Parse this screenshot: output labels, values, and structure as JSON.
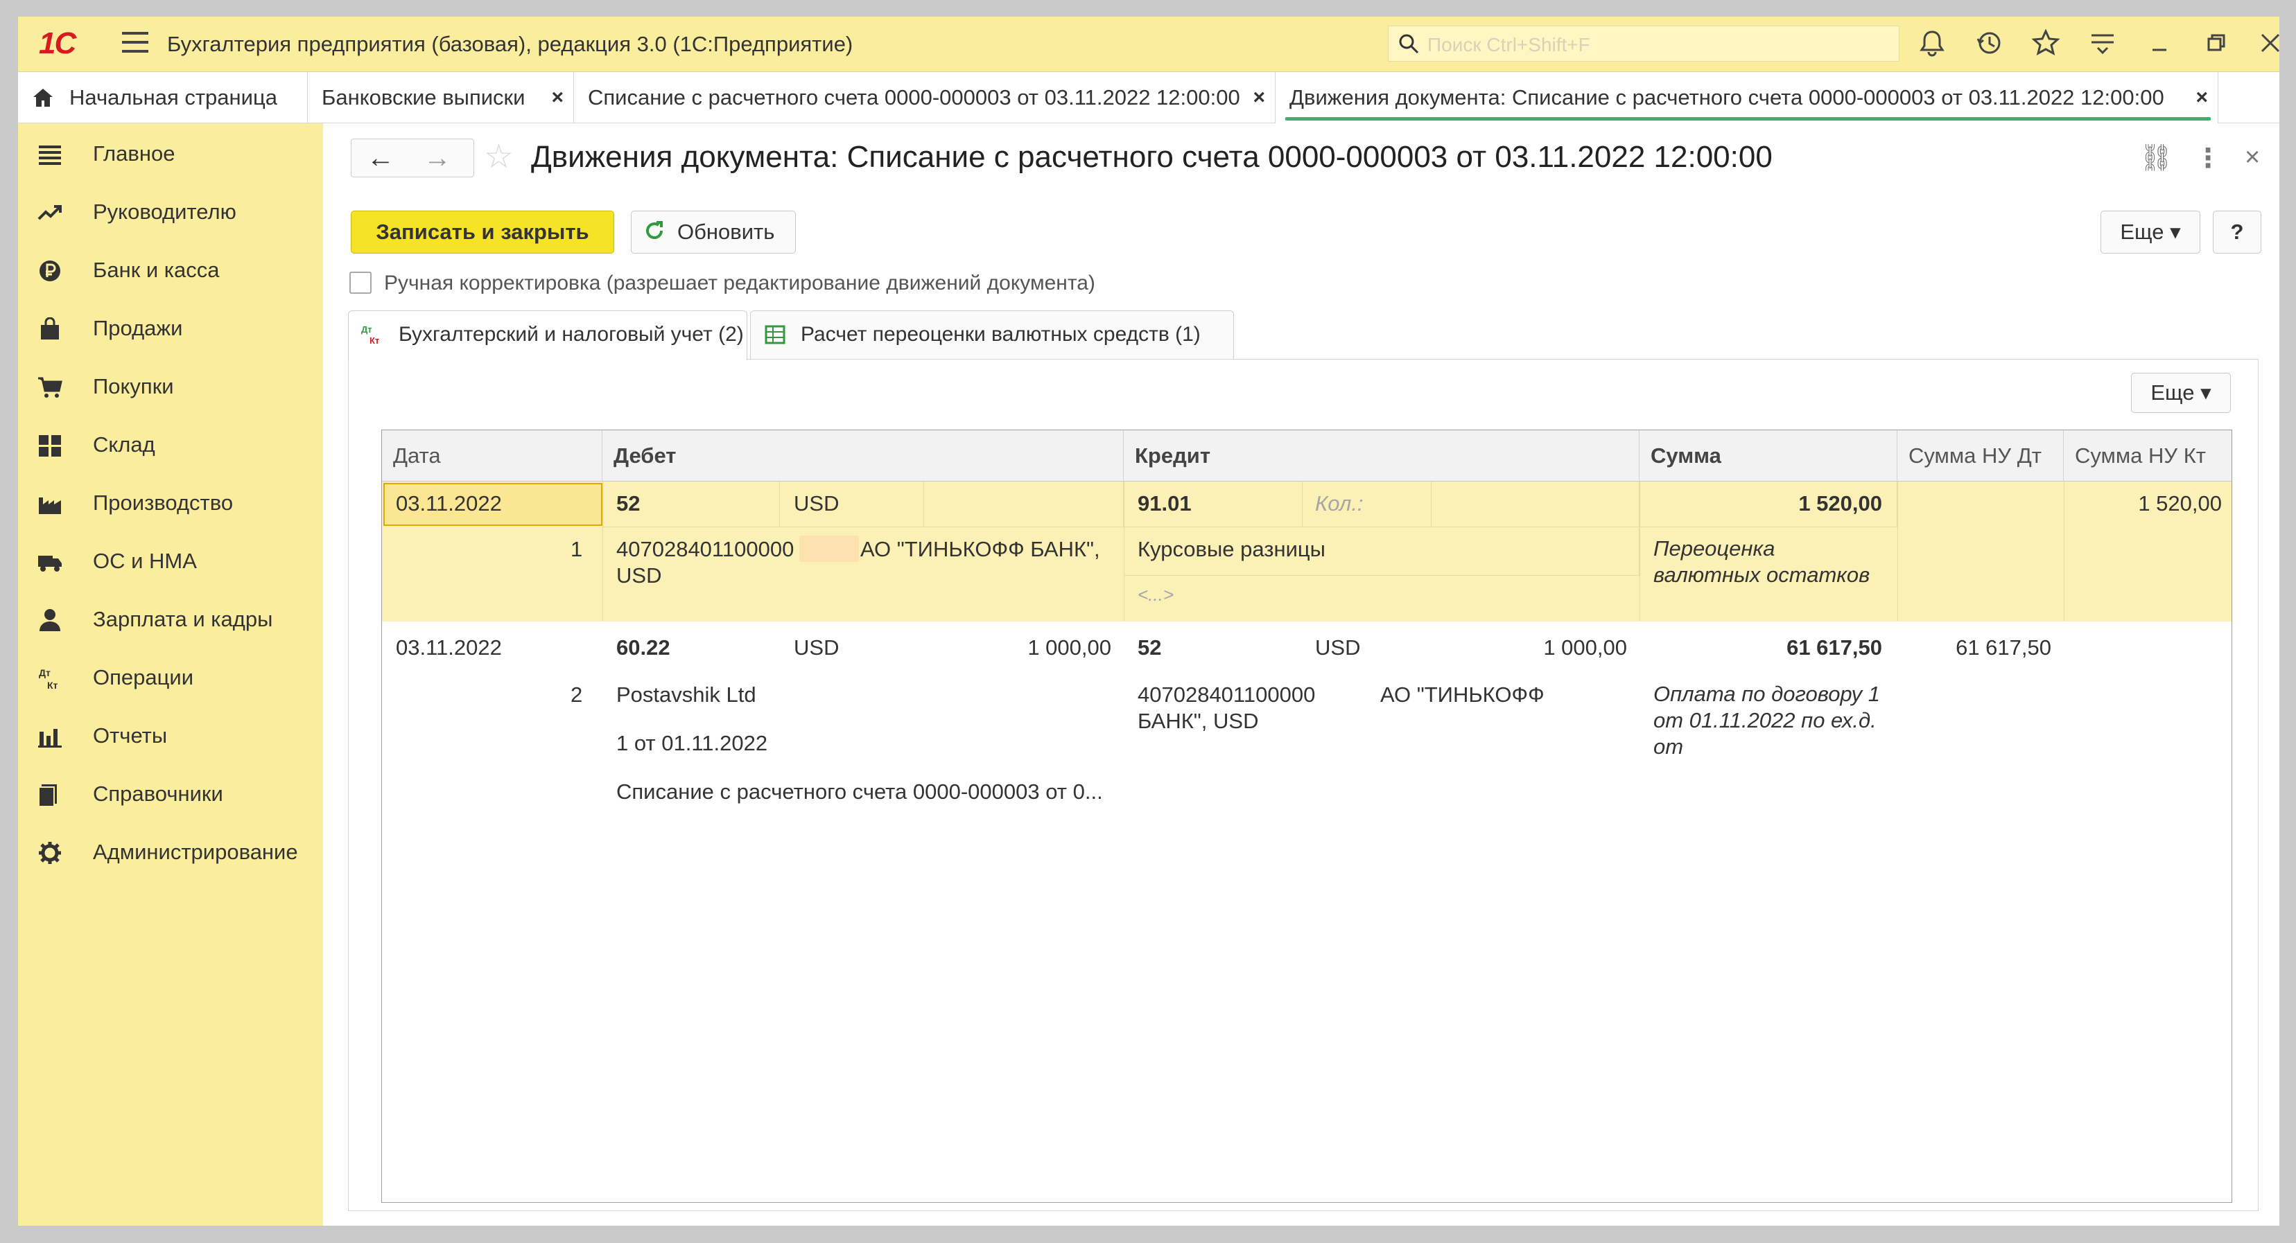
{
  "app": {
    "logo": "1С",
    "title": "Бухгалтерия предприятия (базовая), редакция 3.0  (1С:Предприятие)",
    "search_placeholder": "Поиск Ctrl+Shift+F"
  },
  "tabs": [
    {
      "label": "Начальная страница"
    },
    {
      "label": "Банковские выписки",
      "close": "×"
    },
    {
      "label": "Списание с расчетного счета 0000-000003 от 03.11.2022 12:00:00",
      "close": "×"
    },
    {
      "label": "Движения документа: Списание с расчетного счета 0000-000003 от 03.11.2022 12:00:00",
      "close": "×"
    }
  ],
  "sidebar": {
    "items": [
      {
        "label": "Главное",
        "icon": "menu-icon"
      },
      {
        "label": "Руководителю",
        "icon": "chart-trend-icon"
      },
      {
        "label": "Банк и касса",
        "icon": "ruble-coin-icon"
      },
      {
        "label": "Продажи",
        "icon": "shopping-bag-icon"
      },
      {
        "label": "Покупки",
        "icon": "cart-icon"
      },
      {
        "label": "Склад",
        "icon": "warehouse-icon"
      },
      {
        "label": "Производство",
        "icon": "factory-icon"
      },
      {
        "label": "ОС и НМА",
        "icon": "truck-icon"
      },
      {
        "label": "Зарплата и кадры",
        "icon": "person-icon"
      },
      {
        "label": "Операции",
        "icon": "dt-kt-icon"
      },
      {
        "label": "Отчеты",
        "icon": "bar-chart-icon"
      },
      {
        "label": "Справочники",
        "icon": "books-icon"
      },
      {
        "label": "Администрирование",
        "icon": "gear-icon"
      }
    ]
  },
  "document": {
    "title": "Движения документа: Списание с расчетного счета 0000-000003 от 03.11.2022 12:00:00",
    "back": "←",
    "forward": "→",
    "star": "☆",
    "link_icon": "⛓",
    "more_icon": "⋮",
    "close_icon": "×"
  },
  "toolbar": {
    "save_close": "Записать и закрыть",
    "refresh": "Обновить",
    "more": "Еще ▾",
    "help": "?"
  },
  "manual_edit": {
    "label": "Ручная корректировка (разрешает редактирование движений документа)",
    "checked": false
  },
  "subtabs": [
    {
      "label": "Бухгалтерский и налоговый учет (2)",
      "icon": "dt-kt-icon"
    },
    {
      "label": "Расчет переоценки валютных средств (1)",
      "icon": "table-icon"
    }
  ],
  "table_more": "Еще ▾",
  "table": {
    "headers": [
      "Дата",
      "Дебет",
      "Кредит",
      "Сумма",
      "Сумма НУ Дт",
      "Сумма НУ Кт"
    ],
    "rows": [
      {
        "date": "03.11.2022",
        "num": "1",
        "debit_account": "52",
        "debit_currency": "USD",
        "debit_sub1": "407028401100000",
        "debit_sub1_bank": "АО \"ТИНЬКОФФ БАНК\",",
        "debit_sub1_cont": "USD",
        "credit_account": "91.01",
        "credit_qty_placeholder": "Кол.:",
        "credit_sub1": "Курсовые разницы",
        "credit_sub2": "<...>",
        "sum": "1 520,00",
        "sum_content": "Переоценка валютных остатков",
        "sum_nu_dt": "",
        "sum_nu_kt": "1 520,00"
      },
      {
        "date": "03.11.2022",
        "num": "2",
        "debit_account": "60.22",
        "debit_currency": "USD",
        "debit_currency_amount": "1 000,00",
        "debit_sub1": "Postavshik Ltd",
        "debit_sub2": "1 от 01.11.2022",
        "debit_sub3": "Списание с расчетного счета 0000-000003 от 0...",
        "credit_account": "52",
        "credit_currency": "USD",
        "credit_currency_amount": "1 000,00",
        "credit_sub1": "407028401100000",
        "credit_sub1_bank": "АО \"ТИНЬКОФФ",
        "credit_sub1_cont": "БАНК\", USD",
        "sum": "61 617,50",
        "sum_content": "Оплата по договору 1 от 01.11.2022 по ех.д. от",
        "sum_nu_dt": "61 617,50",
        "sum_nu_kt": ""
      }
    ]
  }
}
